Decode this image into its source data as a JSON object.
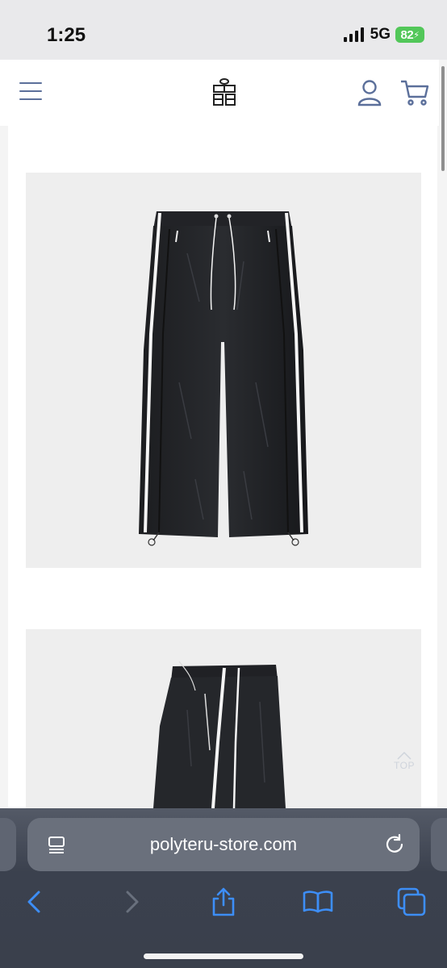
{
  "status_bar": {
    "time": "1:25",
    "network": "5G",
    "battery": "82"
  },
  "header": {
    "menu_icon": "hamburger-icon",
    "logo": "polyteru-logo",
    "account_icon": "user-icon",
    "cart_icon": "cart-icon"
  },
  "main": {
    "images": [
      {
        "subject": "black track pants with white side stripes, front view"
      },
      {
        "subject": "black track pants with white side stripes, angled view"
      }
    ],
    "top_button_label": "TOP"
  },
  "browser": {
    "url": "polyteru-store.com",
    "controls": [
      "back-icon",
      "forward-icon",
      "share-icon",
      "bookmarks-icon",
      "tabs-icon"
    ]
  },
  "colors": {
    "accent_icon": "#5b6f9a",
    "status_bar_bg": "#e9e9eb",
    "battery_green": "#52c759",
    "browser_bar": "#3b414e",
    "link_blue": "#3d8ef7"
  }
}
